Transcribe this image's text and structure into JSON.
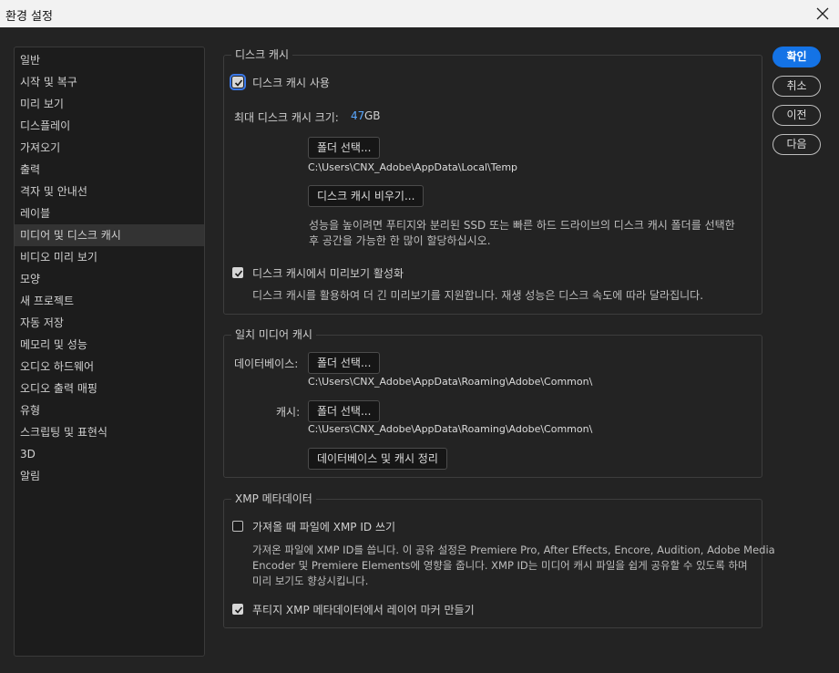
{
  "window": {
    "title": "환경 설정",
    "close_icon": "close-icon"
  },
  "sidebar": {
    "items": [
      {
        "label": "일반"
      },
      {
        "label": "시작 및 복구"
      },
      {
        "label": "미리 보기"
      },
      {
        "label": "디스플레이"
      },
      {
        "label": "가져오기"
      },
      {
        "label": "출력"
      },
      {
        "label": "격자 및 안내선"
      },
      {
        "label": "레이블"
      },
      {
        "label": "미디어 및 디스크 캐시",
        "selected": true
      },
      {
        "label": "비디오 미리 보기"
      },
      {
        "label": "모양"
      },
      {
        "label": "새 프로젝트"
      },
      {
        "label": "자동 저장"
      },
      {
        "label": "메모리 및 성능"
      },
      {
        "label": "오디오 하드웨어"
      },
      {
        "label": "오디오 출력 매핑"
      },
      {
        "label": "유형"
      },
      {
        "label": "스크립팅 및 표현식"
      },
      {
        "label": "3D"
      },
      {
        "label": "알림"
      }
    ]
  },
  "disk_cache": {
    "legend": "디스크 캐시",
    "use_checkbox": {
      "label": "디스크 캐시 사용",
      "checked": true
    },
    "max_size_label": "최대 디스크 캐시 크기:",
    "max_size_value": "47",
    "max_size_unit": "GB",
    "folder_button": "폴더 선택...",
    "folder_path": "C:\\Users\\CNX_Adobe\\AppData\\Local\\Temp",
    "empty_button": "디스크 캐시 비우기...",
    "note_line1": "성능을 높이려면 푸티지와 분리된 SSD 또는 빠른 하드 드라이브의 디스크 캐시 폴더를 선택한",
    "note_line2": "후 공간을 가능한 한 많이 할당하십시오.",
    "preview_checkbox": {
      "label": "디스크 캐시에서 미리보기 활성화",
      "checked": true
    },
    "preview_desc": "디스크 캐시를 활용하여 더 긴 미리보기를 지원합니다. 재생 성능은 디스크 속도에 따라 달라집니다."
  },
  "conformed_cache": {
    "legend": "일치 미디어 캐시",
    "database_label": "데이터베이스:",
    "database_button": "폴더 선택...",
    "database_path": "C:\\Users\\CNX_Adobe\\AppData\\Roaming\\Adobe\\Common\\",
    "cache_label": "캐시:",
    "cache_button": "폴더 선택...",
    "cache_path": "C:\\Users\\CNX_Adobe\\AppData\\Roaming\\Adobe\\Common\\",
    "cleanup_button": "데이터베이스 및 캐시 정리"
  },
  "xmp": {
    "legend": "XMP 메타데이터",
    "write_checkbox": {
      "label": "가져올 때 파일에 XMP ID 쓰기",
      "checked": false
    },
    "desc_line1": "가져온 파일에 XMP ID를 씁니다. 이 공유 설정은 Premiere Pro, After Effects, Encore, Audition, Adobe Media",
    "desc_line2": "Encoder 및 Premiere Elements에 영향을 줍니다. XMP ID는 미디어 캐시 파일을 쉽게 공유할 수 있도록 하며",
    "desc_line3": "미리 보기도 향상시킵니다.",
    "marker_checkbox": {
      "label": "푸티지 XMP 메타데이터에서 레이어 마커 만들기",
      "checked": true
    }
  },
  "actions": {
    "ok": "확인",
    "cancel": "취소",
    "prev": "이전",
    "next": "다음"
  },
  "colors": {
    "accent": "#1473e6",
    "value_blue": "#5aa8ff",
    "background": "#232323"
  }
}
